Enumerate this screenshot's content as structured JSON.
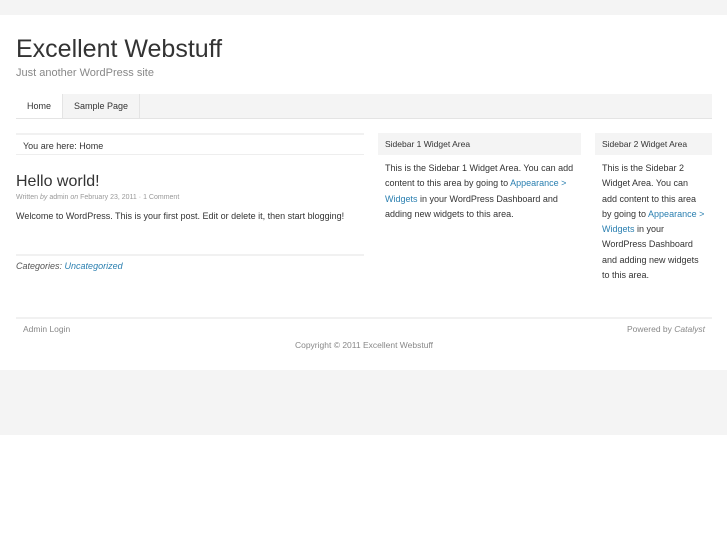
{
  "site": {
    "title": "Excellent Webstuff",
    "tagline": "Just another WordPress site"
  },
  "nav": [
    {
      "label": "Home"
    },
    {
      "label": "Sample Page"
    }
  ],
  "breadcrumb": "You are here: Home",
  "post": {
    "title": "Hello world!",
    "written": "Written",
    "by": "by",
    "author": "admin",
    "on": "on",
    "date": "February 23, 2011",
    "sep": "·",
    "comments": "1 Comment",
    "body": "Welcome to WordPress. This is your first post. Edit or delete it, then start blogging!",
    "categories_label": "Categories:",
    "category": "Uncategorized"
  },
  "sidebar1": {
    "title": "Sidebar 1 Widget Area",
    "text_before": "This is the Sidebar 1 Widget Area. You can add content to this area by going to ",
    "link": "Appearance > Widgets",
    "text_after": " in your WordPress Dashboard and adding new widgets to this area."
  },
  "sidebar2": {
    "title": "Sidebar 2 Widget Area",
    "text_before": "This is the Sidebar 2 Widget Area. You can add content to this area by going to ",
    "link": "Appearance > Widgets",
    "text_after": " in your WordPress Dashboard and adding new widgets to this area."
  },
  "footer": {
    "admin_login": "Admin Login",
    "powered_by": "Powered by",
    "catalyst": "Catalyst",
    "copyright": "Copyright © 2011 Excellent Webstuff"
  }
}
